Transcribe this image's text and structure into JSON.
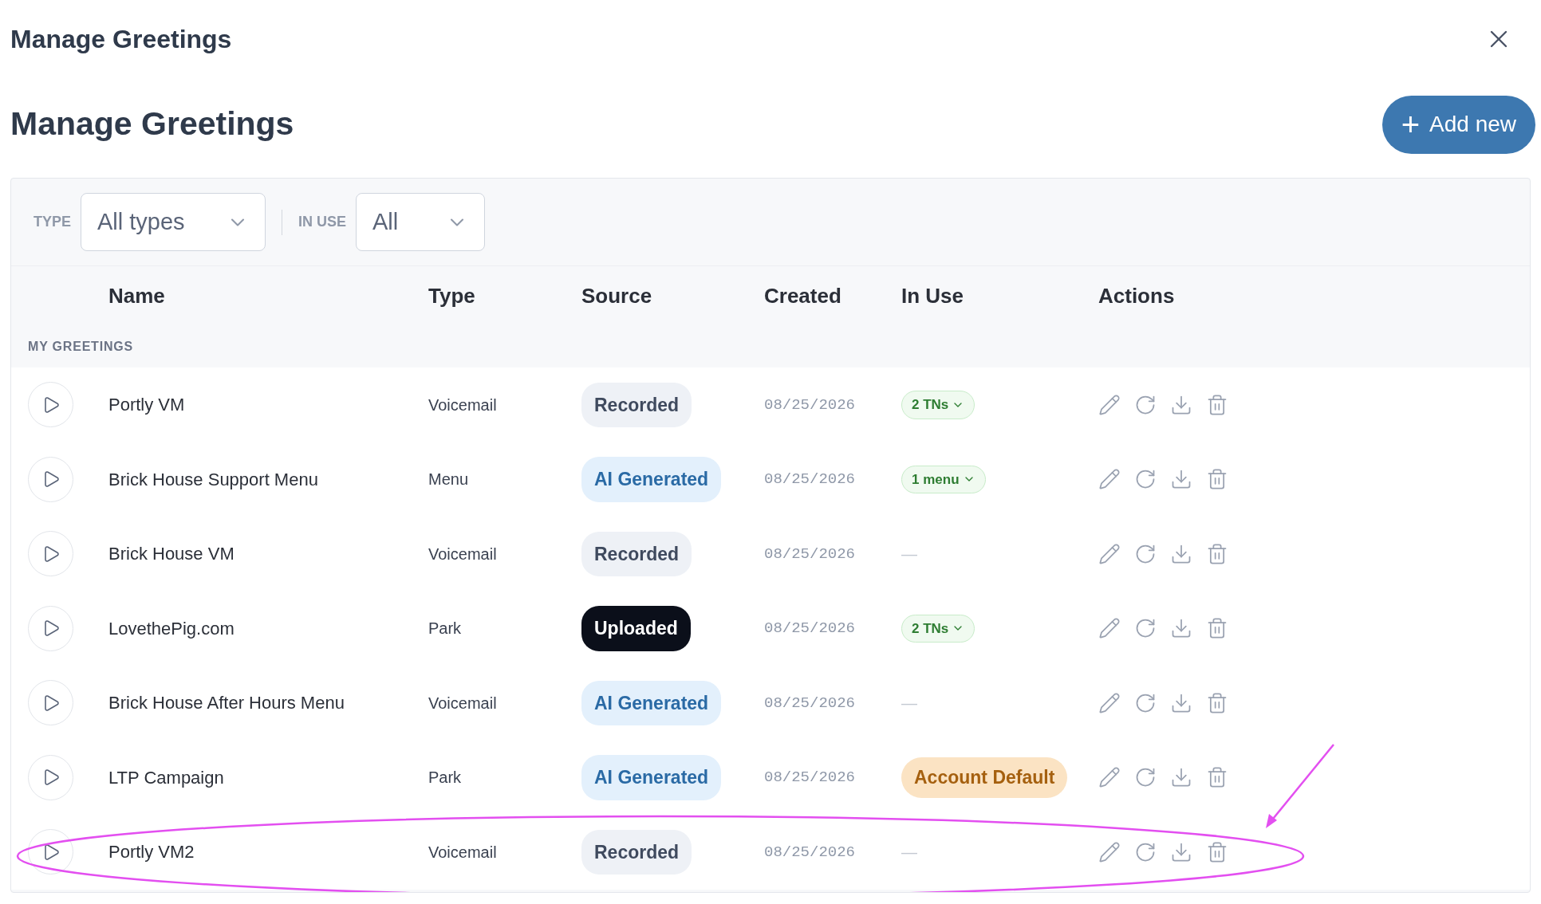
{
  "window": {
    "title": "Manage Greetings"
  },
  "heading": "Manage Greetings",
  "add_button": {
    "icon": "+",
    "label": "Add new"
  },
  "filters": [
    {
      "label": "TYPE",
      "value": "All types"
    },
    {
      "label": "IN USE",
      "value": "All"
    }
  ],
  "columns": [
    "Name",
    "Type",
    "Source",
    "Created",
    "In Use",
    "Actions"
  ],
  "section": "MY GREETINGS",
  "rows": [
    {
      "name": "Portly VM",
      "type": "Voicemail",
      "source": {
        "kind": "recorded",
        "label": "Recorded"
      },
      "created": "08/25/2026",
      "in_use": {
        "kind": "tag",
        "label": "2 TNs"
      },
      "highlighted": false
    },
    {
      "name": "Brick House Support Menu",
      "type": "Menu",
      "source": {
        "kind": "ai",
        "label": "AI Generated"
      },
      "created": "08/25/2026",
      "in_use": {
        "kind": "tag",
        "label": "1 menu"
      },
      "highlighted": false
    },
    {
      "name": "Brick House VM",
      "type": "Voicemail",
      "source": {
        "kind": "recorded",
        "label": "Recorded"
      },
      "created": "08/25/2026",
      "in_use": {
        "kind": "none",
        "label": "—"
      },
      "highlighted": false
    },
    {
      "name": "LovethePig.com",
      "type": "Park",
      "source": {
        "kind": "uploaded",
        "label": "Uploaded"
      },
      "created": "08/25/2026",
      "in_use": {
        "kind": "tag",
        "label": "2 TNs"
      },
      "highlighted": false
    },
    {
      "name": "Brick House After Hours Menu",
      "type": "Voicemail",
      "source": {
        "kind": "ai",
        "label": "AI Generated"
      },
      "created": "08/25/2026",
      "in_use": {
        "kind": "none",
        "label": "—"
      },
      "highlighted": false
    },
    {
      "name": "LTP Campaign",
      "type": "Park",
      "source": {
        "kind": "ai",
        "label": "AI Generated"
      },
      "created": "08/25/2026",
      "in_use": {
        "kind": "default",
        "label": "Account Default"
      },
      "highlighted": false
    },
    {
      "name": "Portly VM2",
      "type": "Voicemail",
      "source": {
        "kind": "recorded",
        "label": "Recorded"
      },
      "created": "08/25/2026",
      "in_use": {
        "kind": "none",
        "label": "—"
      },
      "highlighted": true
    }
  ]
}
